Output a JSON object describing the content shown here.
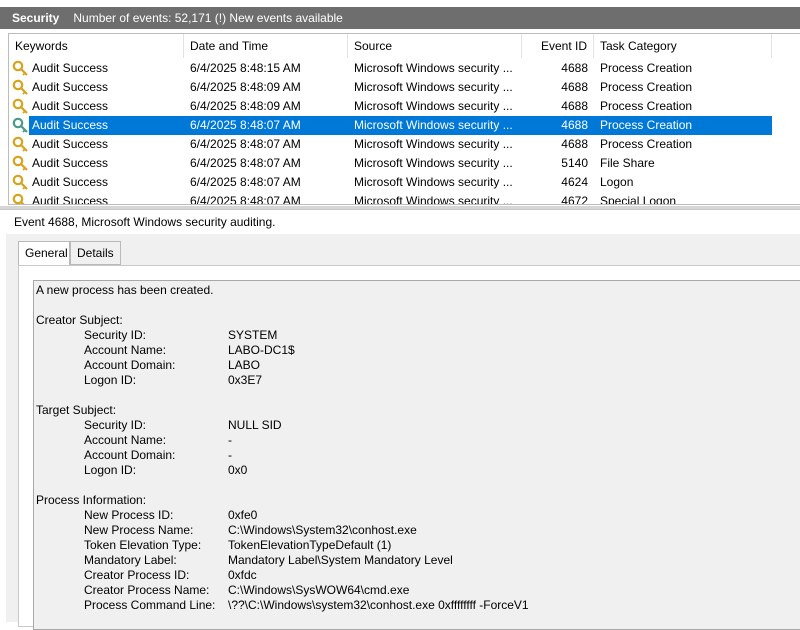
{
  "title_bar": {
    "title": "Security",
    "event_count": "Number of events: 52,171 (!) New events available"
  },
  "columns": [
    "Keywords",
    "Date and Time",
    "Source",
    "Event ID",
    "Task Category"
  ],
  "events": [
    {
      "keywords": "Audit Success",
      "datetime": "6/4/2025 8:48:15 AM",
      "source": "Microsoft Windows security ...",
      "event_id": "4688",
      "task": "Process Creation",
      "selected": false
    },
    {
      "keywords": "Audit Success",
      "datetime": "6/4/2025 8:48:09 AM",
      "source": "Microsoft Windows security ...",
      "event_id": "4688",
      "task": "Process Creation",
      "selected": false
    },
    {
      "keywords": "Audit Success",
      "datetime": "6/4/2025 8:48:09 AM",
      "source": "Microsoft Windows security ...",
      "event_id": "4688",
      "task": "Process Creation",
      "selected": false
    },
    {
      "keywords": "Audit Success",
      "datetime": "6/4/2025 8:48:07 AM",
      "source": "Microsoft Windows security ...",
      "event_id": "4688",
      "task": "Process Creation",
      "selected": true
    },
    {
      "keywords": "Audit Success",
      "datetime": "6/4/2025 8:48:07 AM",
      "source": "Microsoft Windows security ...",
      "event_id": "4688",
      "task": "Process Creation",
      "selected": false
    },
    {
      "keywords": "Audit Success",
      "datetime": "6/4/2025 8:48:07 AM",
      "source": "Microsoft Windows security ...",
      "event_id": "5140",
      "task": "File Share",
      "selected": false
    },
    {
      "keywords": "Audit Success",
      "datetime": "6/4/2025 8:48:07 AM",
      "source": "Microsoft Windows security ...",
      "event_id": "4624",
      "task": "Logon",
      "selected": false
    },
    {
      "keywords": "Audit Success",
      "datetime": "6/4/2025 8:48:07 AM",
      "source": "Microsoft Windows security ...",
      "event_id": "4672",
      "task": "Special Logon",
      "selected": false
    }
  ],
  "detail": {
    "header": "Event 4688, Microsoft Windows security auditing.",
    "tabs": [
      "General",
      "Details"
    ],
    "active_tab": "General",
    "intro": "A new process has been created.",
    "sections": [
      {
        "title": "Creator Subject:",
        "fields": [
          {
            "label": "Security ID:",
            "value": "SYSTEM"
          },
          {
            "label": "Account Name:",
            "value": "LABO-DC1$"
          },
          {
            "label": "Account Domain:",
            "value": "LABO"
          },
          {
            "label": "Logon ID:",
            "value": "0x3E7"
          }
        ]
      },
      {
        "title": "Target Subject:",
        "fields": [
          {
            "label": "Security ID:",
            "value": "NULL SID"
          },
          {
            "label": "Account Name:",
            "value": "-"
          },
          {
            "label": "Account Domain:",
            "value": "-"
          },
          {
            "label": "Logon ID:",
            "value": "0x0"
          }
        ]
      },
      {
        "title": "Process Information:",
        "fields": [
          {
            "label": "New Process ID:",
            "value": "0xfe0"
          },
          {
            "label": "New Process Name:",
            "value": "C:\\Windows\\System32\\conhost.exe"
          },
          {
            "label": "Token Elevation Type:",
            "value": "TokenElevationTypeDefault (1)"
          },
          {
            "label": "Mandatory Label:",
            "value": "Mandatory Label\\System Mandatory Level"
          },
          {
            "label": "Creator Process ID:",
            "value": "0xfdc"
          },
          {
            "label": "Creator Process Name:",
            "value": "C:\\Windows\\SysWOW64\\cmd.exe"
          },
          {
            "label": "Process Command Line:",
            "value": "\\??\\C:\\Windows\\system32\\conhost.exe 0xffffffff -ForceV1"
          }
        ]
      }
    ]
  },
  "icons": {
    "row_icon": "key-icon"
  },
  "colors": {
    "selection": "#0078d7",
    "title_bar": "#6e6e6e",
    "key_gold": "#d9a21b",
    "key_selected": "#4a9a8a"
  }
}
